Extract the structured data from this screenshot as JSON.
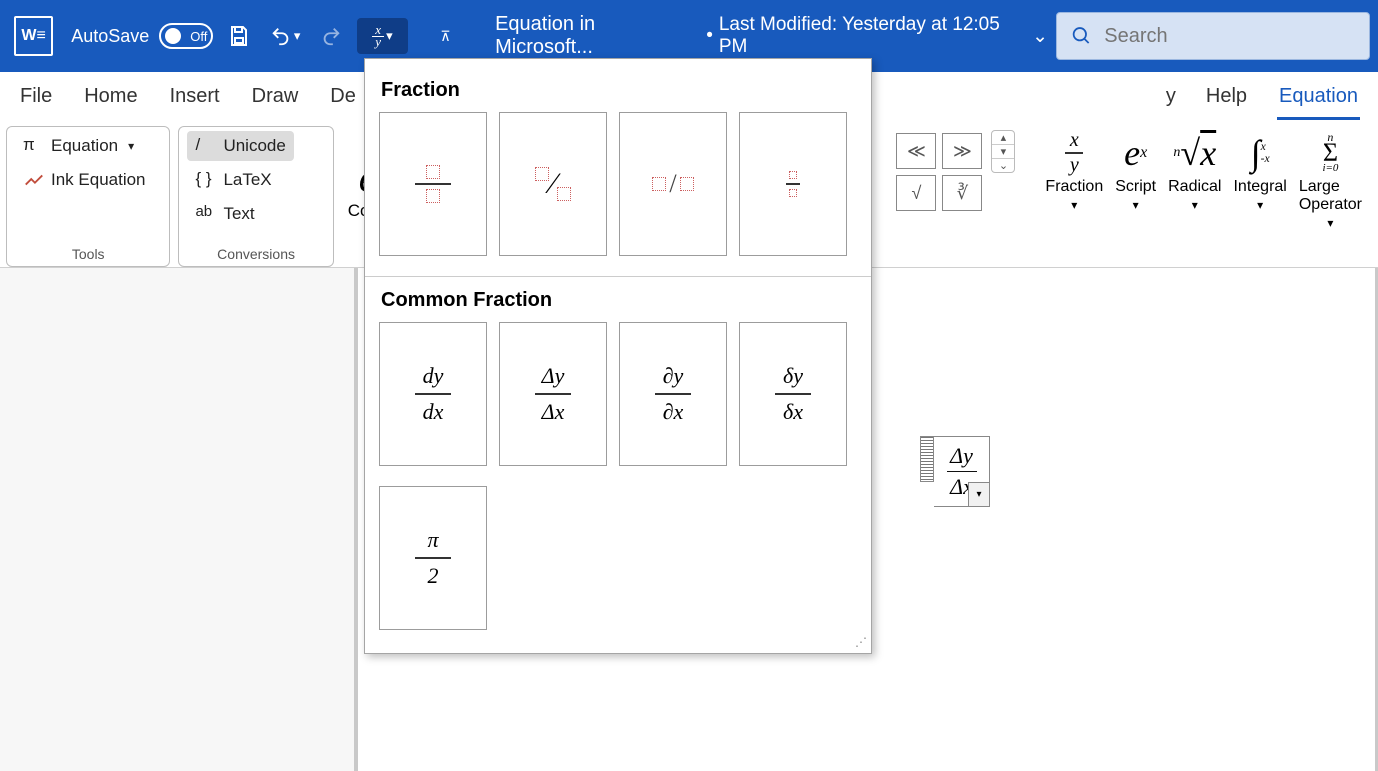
{
  "title_bar": {
    "autosave_label": "AutoSave",
    "toggle_text": "Off",
    "doc_title": "Equation in Microsoft...",
    "modified_label": "Last Modified: Yesterday at 12:05 PM",
    "search_placeholder": "Search"
  },
  "tabs": {
    "file": "File",
    "home": "Home",
    "insert": "Insert",
    "draw": "Draw",
    "remaining_cut": "De",
    "help": "Help",
    "equation": "Equation",
    "other_cut": "y"
  },
  "ribbon": {
    "tools": {
      "title": "Tools",
      "equation_btn": "Equation",
      "ink_btn": "Ink Equation"
    },
    "conversions": {
      "title": "Conversions",
      "unicode": "Unicode",
      "latex": "LaTeX",
      "text": "Text",
      "convert_prefix": "Conv"
    },
    "bracket_cells": [
      "≪",
      "≫",
      "√",
      "∛"
    ],
    "structures": {
      "fraction": "Fraction",
      "script": "Script",
      "radical": "Radical",
      "integral": "Integral",
      "large_op": "Large\nOperator"
    }
  },
  "dropdown": {
    "section_fraction": "Fraction",
    "section_common": "Common Fraction",
    "fraction_templates": [
      {
        "kind": "stacked"
      },
      {
        "kind": "skewed"
      },
      {
        "kind": "linear"
      },
      {
        "kind": "small"
      }
    ],
    "common_fractions": [
      {
        "top": "dy",
        "bot": "dx"
      },
      {
        "top": "Δy",
        "bot": "Δx"
      },
      {
        "top": "∂y",
        "bot": "∂x"
      },
      {
        "top": "δy",
        "bot": "δx"
      },
      {
        "top": "π",
        "bot": "2"
      }
    ]
  },
  "equation_on_page": {
    "top": "Δy",
    "bot": "Δx"
  }
}
